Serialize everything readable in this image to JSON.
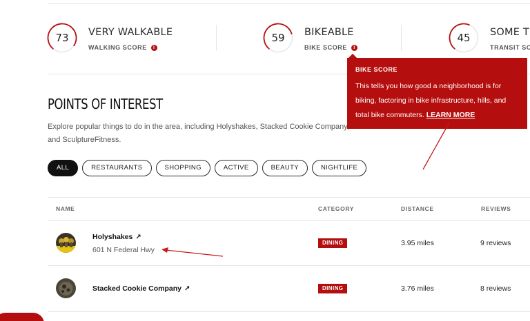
{
  "scores": [
    {
      "value": "73",
      "title": "VERY WALKABLE",
      "label": "WALKING SCORE"
    },
    {
      "value": "59",
      "title": "BIKEABLE",
      "label": "BIKE SCORE"
    },
    {
      "value": "45",
      "title": "SOME TRANSIT",
      "label": "TRANSIT SCORE"
    }
  ],
  "info_glyph": "i",
  "tooltip": {
    "title": "BIKE SCORE",
    "body": "This tells you how good a neighborhood is for biking, factoring in bike infrastructure, hills, and total bike commuters.",
    "link": "LEARN MORE"
  },
  "poi": {
    "title": "POINTS OF INTEREST",
    "description": "Explore popular things to do in the area, including Holyshakes, Stacked Cookie Company, and SculptureFitness."
  },
  "filters": [
    "ALL",
    "RESTAURANTS",
    "SHOPPING",
    "ACTIVE",
    "BEAUTY",
    "NIGHTLIFE"
  ],
  "table": {
    "headers": {
      "name": "NAME",
      "category": "CATEGORY",
      "distance": "DISTANCE",
      "reviews": "REVIEWS"
    },
    "rows": [
      {
        "name": "Holyshakes",
        "address": "601 N Federal Hwy",
        "category": "DINING",
        "distance": "3.95 miles",
        "reviews": "9 reviews"
      },
      {
        "name": "Stacked Cookie Company",
        "category": "DINING",
        "distance": "3.76 miles",
        "reviews": "8 reviews"
      }
    ]
  },
  "external_glyph": "↗",
  "colors": {
    "accent": "#b50e0e",
    "gauge_track": "#e8e8e8"
  }
}
